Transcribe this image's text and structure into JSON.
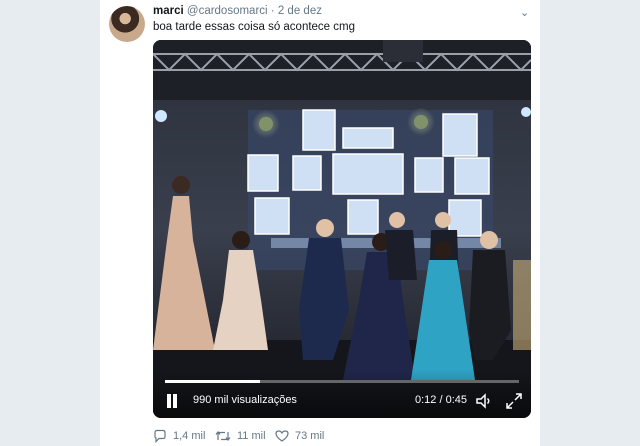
{
  "tweet": {
    "display_name": "marci",
    "handle": "@cardosomarci",
    "separator": "·",
    "date": "2 de dez",
    "text": "boa tarde essas coisa só acontece cmg"
  },
  "video": {
    "views": "990 mil visualizações",
    "time": "0:12 / 0:45",
    "progress_fraction": 0.267
  },
  "actions": {
    "replies": "1,4 mil",
    "retweets": "11 mil",
    "likes": "73 mil"
  },
  "icons": {
    "reply": "comment-icon",
    "retweet": "retweet-icon",
    "like": "heart-icon",
    "menu": "chevron-down-icon",
    "pause": "pause-icon",
    "volume": "volume-icon",
    "fullscreen": "fullscreen-icon"
  },
  "colors": {
    "background": "#e6ecf0",
    "text": "#14171a",
    "secondary": "#657786"
  }
}
